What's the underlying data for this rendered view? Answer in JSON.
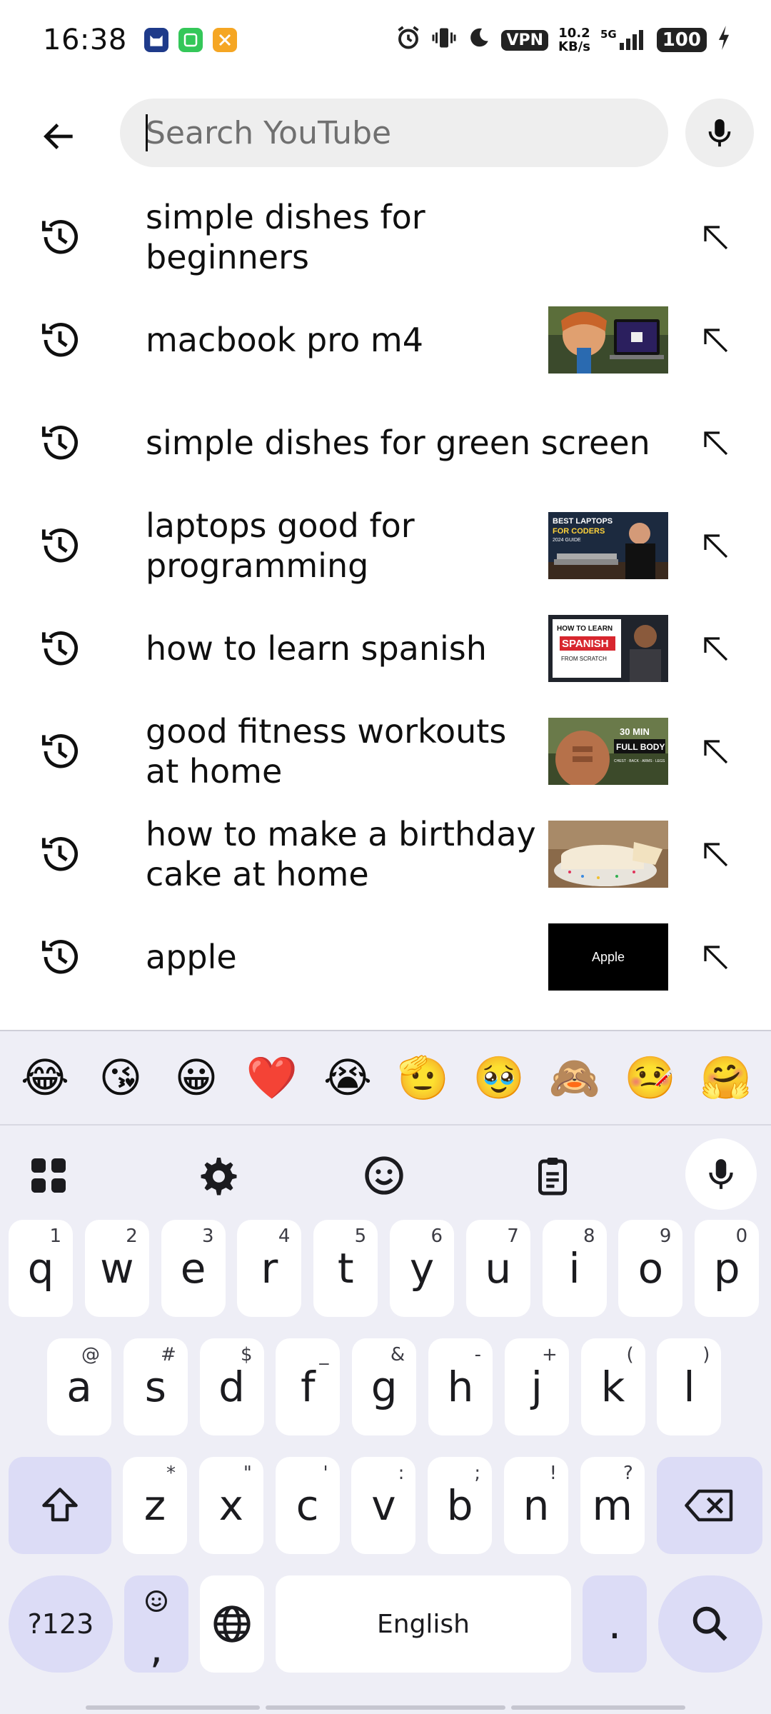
{
  "status_bar": {
    "time": "16:38",
    "vpn": "VPN",
    "speed_value": "10.2",
    "speed_unit": "KB/s",
    "network": "5G",
    "battery": "100"
  },
  "search": {
    "placeholder": "Search YouTube"
  },
  "suggestions": [
    {
      "text": "simple dishes for beginners",
      "thumbnail": null
    },
    {
      "text": "macbook pro m4",
      "thumbnail": "macbook"
    },
    {
      "text": "simple dishes for green screen",
      "thumbnail": null
    },
    {
      "text": "laptops good for programming",
      "thumbnail": "laptops"
    },
    {
      "text": "how to learn spanish",
      "thumbnail": "spanish"
    },
    {
      "text": "good fitness workouts at home",
      "thumbnail": "fitness"
    },
    {
      "text": "how to make a birthday cake at home",
      "thumbnail": "cake"
    },
    {
      "text": "apple",
      "thumbnail": "apple"
    }
  ],
  "thumbnail_texts": {
    "laptops_line1": "BEST LAPTOPS",
    "laptops_line2": "FOR CODERS",
    "laptops_line3": "2024 GUIDE",
    "spanish_line1": "HOW TO LEARN",
    "spanish_line2": "SPANISH",
    "spanish_line3": "FROM SCRATCH",
    "fitness_line1": "30 MIN",
    "fitness_line2": "FULL BODY",
    "fitness_line3": "CHEST · BACK · ARMS · LEGS",
    "apple": "Apple"
  },
  "keyboard": {
    "emojis": [
      "😂",
      "😘",
      "😀",
      "❤️",
      "😭",
      "🫡",
      "🥹",
      "🙈",
      "🤒",
      "🤗"
    ],
    "row1": [
      {
        "k": "q",
        "h": "1"
      },
      {
        "k": "w",
        "h": "2"
      },
      {
        "k": "e",
        "h": "3"
      },
      {
        "k": "r",
        "h": "4"
      },
      {
        "k": "t",
        "h": "5"
      },
      {
        "k": "y",
        "h": "6"
      },
      {
        "k": "u",
        "h": "7"
      },
      {
        "k": "i",
        "h": "8"
      },
      {
        "k": "o",
        "h": "9"
      },
      {
        "k": "p",
        "h": "0"
      }
    ],
    "row2": [
      {
        "k": "a",
        "h": "@"
      },
      {
        "k": "s",
        "h": "#"
      },
      {
        "k": "d",
        "h": "$"
      },
      {
        "k": "f",
        "h": "_"
      },
      {
        "k": "g",
        "h": "&"
      },
      {
        "k": "h",
        "h": "-"
      },
      {
        "k": "j",
        "h": "+"
      },
      {
        "k": "k",
        "h": "("
      },
      {
        "k": "l",
        "h": ")"
      }
    ],
    "row3": [
      {
        "k": "z",
        "h": "*"
      },
      {
        "k": "x",
        "h": "\""
      },
      {
        "k": "c",
        "h": "'"
      },
      {
        "k": "v",
        "h": ":"
      },
      {
        "k": "b",
        "h": ";"
      },
      {
        "k": "n",
        "h": "!"
      },
      {
        "k": "m",
        "h": "?"
      }
    ],
    "symbols_label": "?123",
    "comma": ",",
    "space_label": "English",
    "period": "."
  }
}
